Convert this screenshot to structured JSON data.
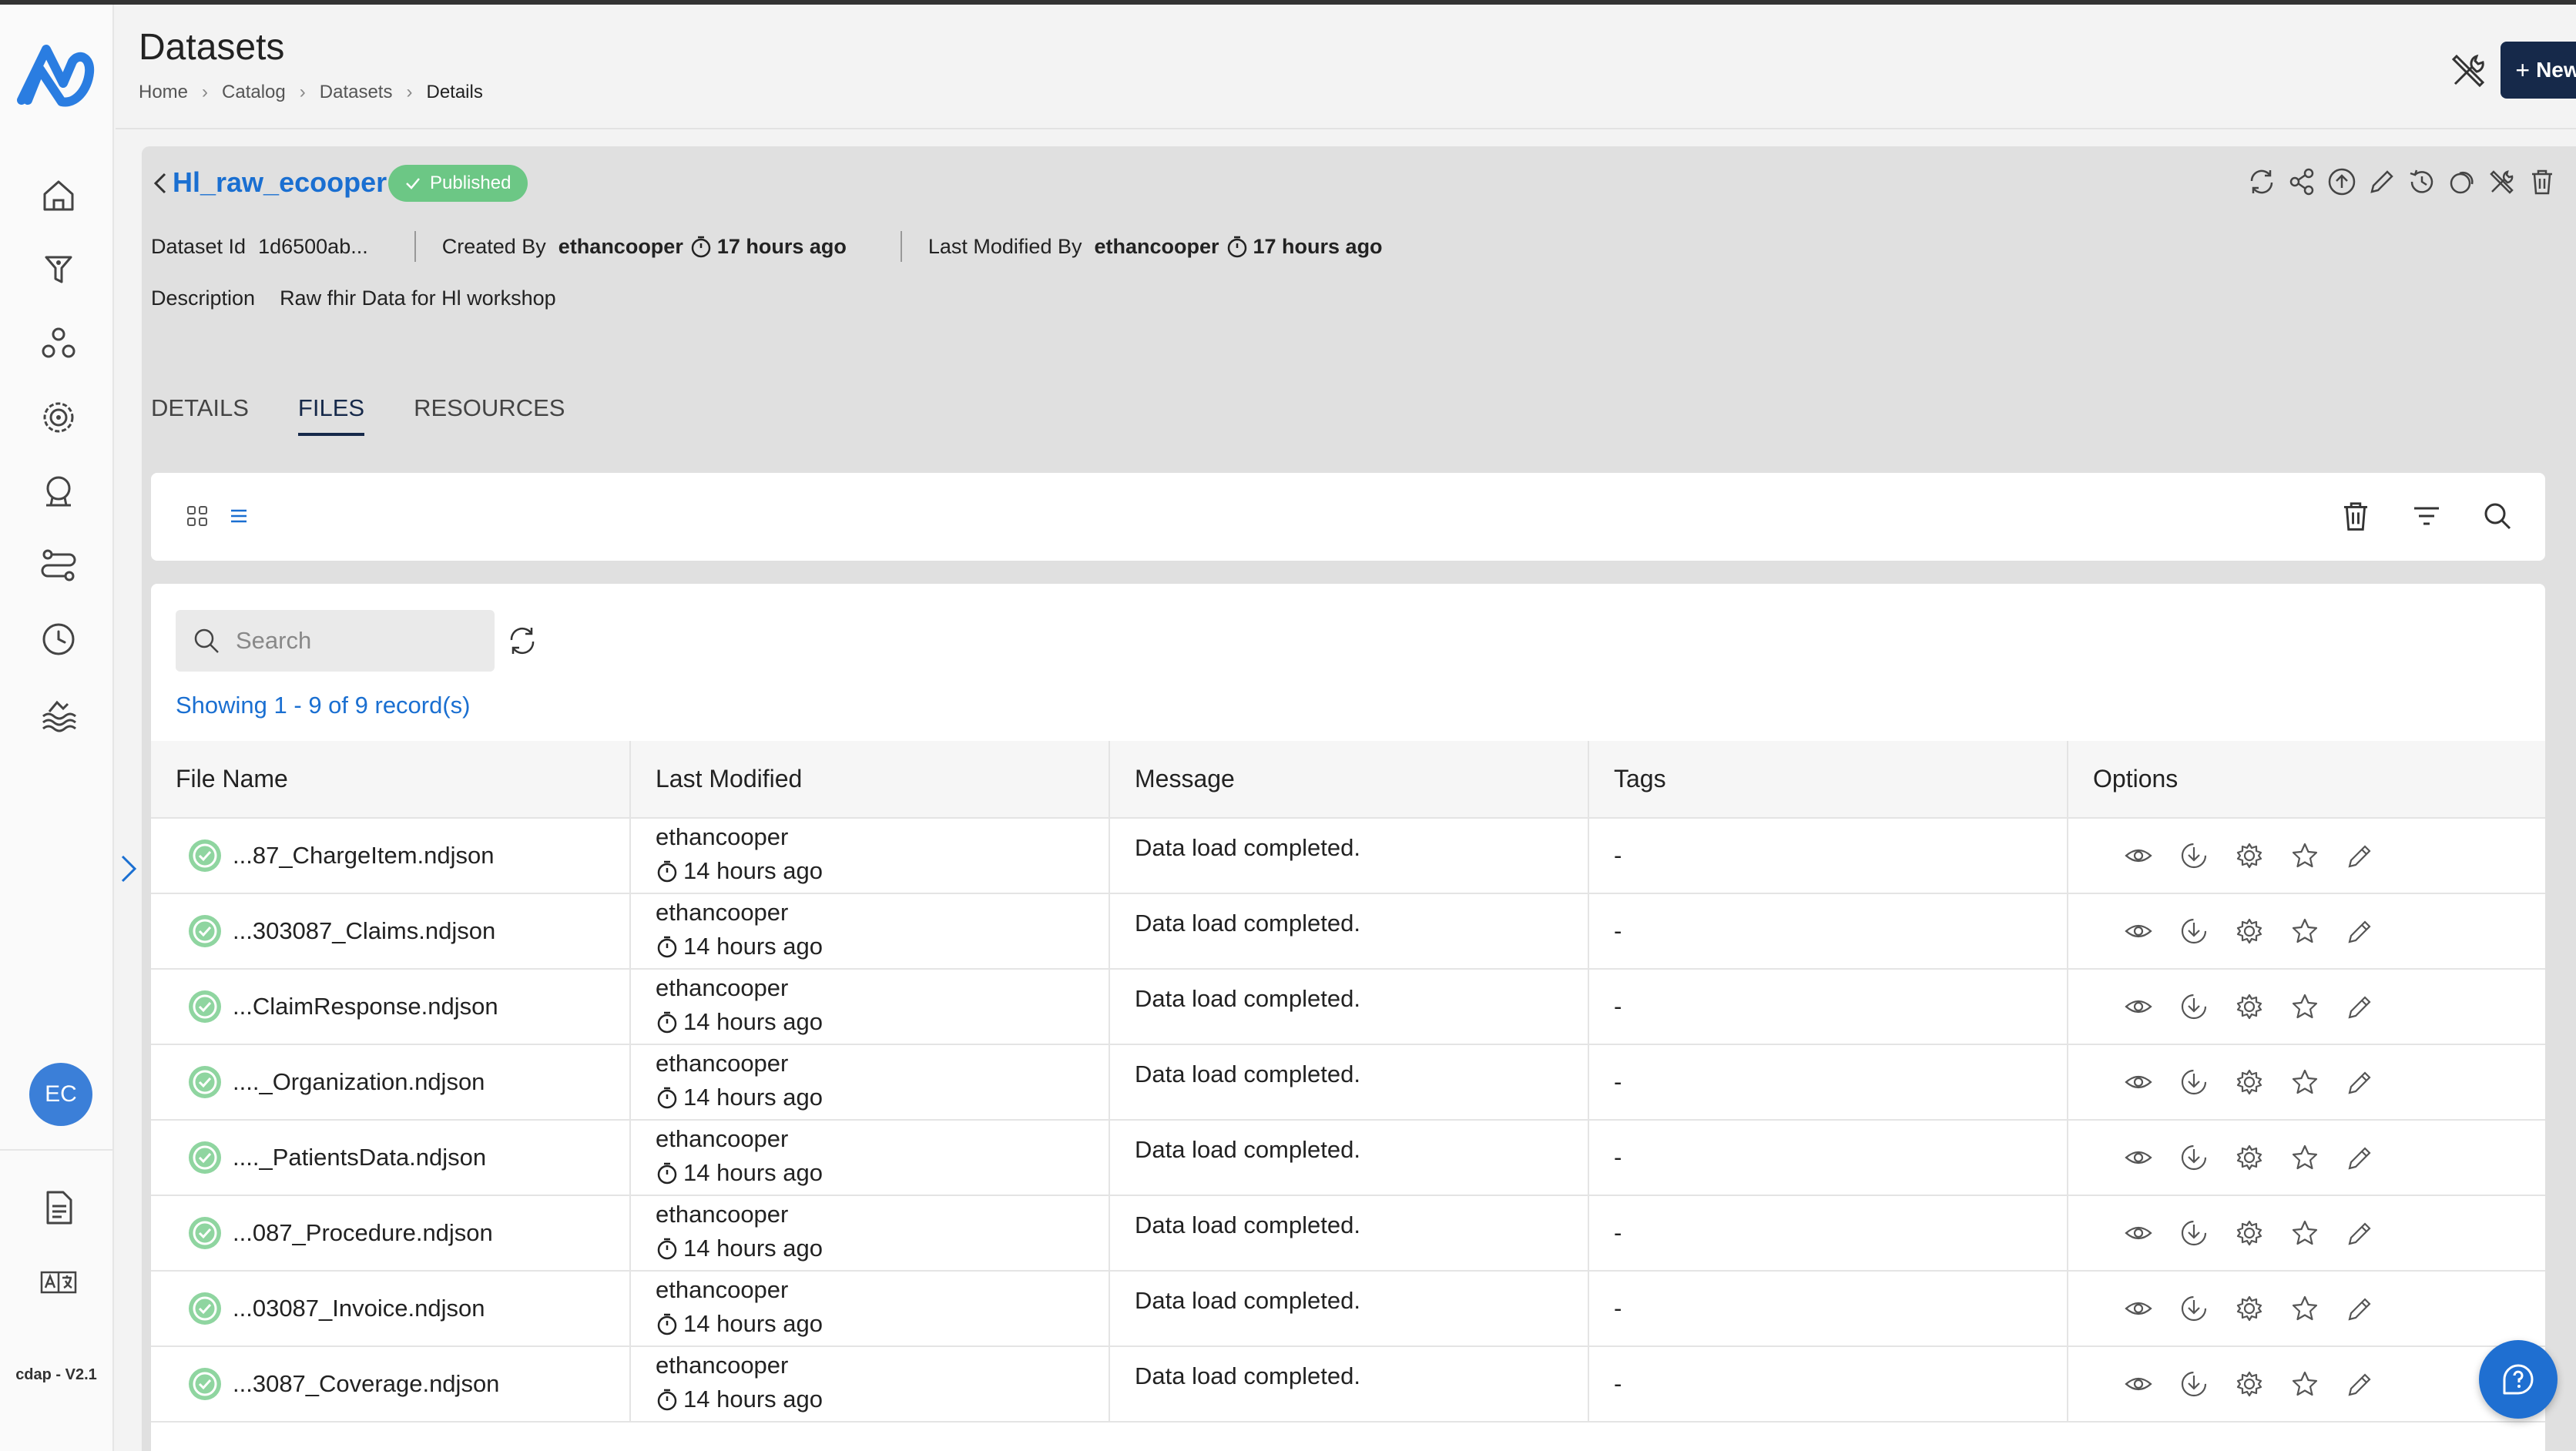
{
  "app": {
    "version": "cdap - V2.1",
    "user_initials": "EC",
    "colors": {
      "primary": "#16294a",
      "accent": "#1a6fd1",
      "success": "#6cc785"
    }
  },
  "sidebar": {
    "items": [
      {
        "name": "home-icon"
      },
      {
        "name": "funnel-icon"
      },
      {
        "name": "network-icon"
      },
      {
        "name": "target-icon"
      },
      {
        "name": "award-icon"
      },
      {
        "name": "pipeline-icon"
      },
      {
        "name": "clock-icon"
      },
      {
        "name": "waves-icon"
      }
    ],
    "bottom_items": [
      {
        "name": "document-icon"
      },
      {
        "name": "translate-icon"
      }
    ]
  },
  "header": {
    "title": "Datasets",
    "breadcrumb": [
      "Home",
      "Catalog",
      "Datasets",
      "Details"
    ],
    "new_button": "New Dataset"
  },
  "dataset": {
    "name": "Hl_raw_ecooper",
    "status": "Published",
    "id_label": "Dataset Id",
    "id_value": "1d6500ab...",
    "created_label": "Created By",
    "created_by": "ethancooper",
    "created_ago": "17 hours ago",
    "modified_label": "Last Modified By",
    "modified_by": "ethancooper",
    "modified_ago": "17 hours ago",
    "description_label": "Description",
    "description": "Raw fhir Data for Hl workshop"
  },
  "tabs": [
    {
      "label": "DETAILS",
      "active": false
    },
    {
      "label": "FILES",
      "active": true
    },
    {
      "label": "RESOURCES",
      "active": false
    }
  ],
  "files": {
    "search_placeholder": "Search",
    "showing": "Showing 1 - 9 of 9 record(s)",
    "columns": [
      "File Name",
      "Last Modified",
      "Message",
      "Tags",
      "Options"
    ],
    "rows": [
      {
        "file": "...87_ChargeItem.ndjson",
        "user": "ethancooper",
        "ago": "14 hours ago",
        "message": "Data load completed.",
        "tags": "-"
      },
      {
        "file": "...303087_Claims.ndjson",
        "user": "ethancooper",
        "ago": "14 hours ago",
        "message": "Data load completed.",
        "tags": "-"
      },
      {
        "file": "...ClaimResponse.ndjson",
        "user": "ethancooper",
        "ago": "14 hours ago",
        "message": "Data load completed.",
        "tags": "-"
      },
      {
        "file": "...._Organization.ndjson",
        "user": "ethancooper",
        "ago": "14 hours ago",
        "message": "Data load completed.",
        "tags": "-"
      },
      {
        "file": "...._PatientsData.ndjson",
        "user": "ethancooper",
        "ago": "14 hours ago",
        "message": "Data load completed.",
        "tags": "-"
      },
      {
        "file": "...087_Procedure.ndjson",
        "user": "ethancooper",
        "ago": "14 hours ago",
        "message": "Data load completed.",
        "tags": "-"
      },
      {
        "file": "...03087_Invoice.ndjson",
        "user": "ethancooper",
        "ago": "14 hours ago",
        "message": "Data load completed.",
        "tags": "-"
      },
      {
        "file": "...3087_Coverage.ndjson",
        "user": "ethancooper",
        "ago": "14 hours ago",
        "message": "Data load completed.",
        "tags": "-"
      }
    ]
  }
}
